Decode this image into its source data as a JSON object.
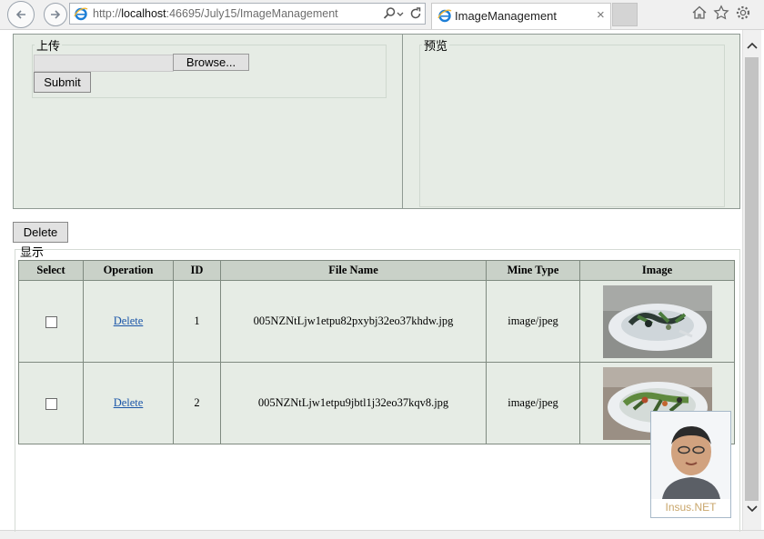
{
  "browser": {
    "url_prefix": "http://",
    "url_host": "localhost",
    "url_rest": ":46695/July15/ImageManagement",
    "tab_title": "ImageManagement",
    "tab_close": "×"
  },
  "upload": {
    "legend": "上传",
    "browse_label": "Browse...",
    "submit_label": "Submit"
  },
  "preview": {
    "legend": "预览"
  },
  "toolbar": {
    "delete_label": "Delete"
  },
  "display": {
    "legend": "显示"
  },
  "table": {
    "headers": [
      "Select",
      "Operation",
      "ID",
      "File Name",
      "Mine Type",
      "Image"
    ],
    "rows": [
      {
        "checked": false,
        "operation": "Delete",
        "id": "1",
        "file_name": "005NZNtLjw1etpu82pxybj32eo37khdw.jpg",
        "mime": "image/jpeg",
        "image": "dish-photo-1"
      },
      {
        "checked": false,
        "operation": "Delete",
        "id": "2",
        "file_name": "005NZNtLjw1etpu9jbtl1j32eo37kqv8.jpg",
        "mime": "image/jpeg",
        "image": "dish-photo-2"
      }
    ]
  },
  "watermark": {
    "text": "Insus.NET"
  },
  "colors": {
    "panel_bg": "#e6ece5",
    "header_bg": "#c9d1c8",
    "border": "#7f8a80",
    "link": "#1a55a8"
  }
}
